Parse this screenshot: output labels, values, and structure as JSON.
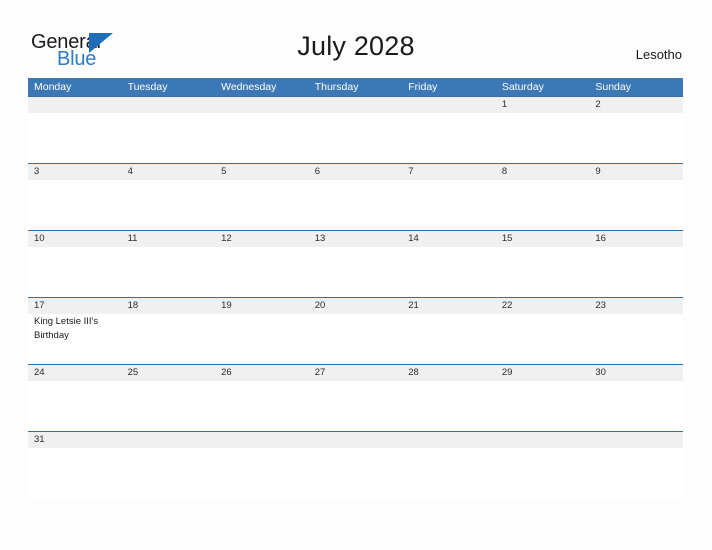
{
  "brand": {
    "name_part1": "General",
    "name_part2": "Blue",
    "triangle_color": "#1f6fb8",
    "blue_text_color": "#2d7cc4"
  },
  "header": {
    "title": "July 2028",
    "country": "Lesotho"
  },
  "theme": {
    "header_blue": "#3c78b5",
    "row_border_blue": "#2f6fad",
    "date_band_gray": "#f0f0f0",
    "page_background": "#fdfdfd",
    "text_color": "#1a1a1a"
  },
  "weekdays": [
    "Monday",
    "Tuesday",
    "Wednesday",
    "Thursday",
    "Friday",
    "Saturday",
    "Sunday"
  ],
  "weeks": [
    {
      "days": [
        {
          "num": "",
          "events": []
        },
        {
          "num": "",
          "events": []
        },
        {
          "num": "",
          "events": []
        },
        {
          "num": "",
          "events": []
        },
        {
          "num": "",
          "events": []
        },
        {
          "num": "1",
          "events": []
        },
        {
          "num": "2",
          "events": []
        }
      ]
    },
    {
      "days": [
        {
          "num": "3",
          "events": []
        },
        {
          "num": "4",
          "events": []
        },
        {
          "num": "5",
          "events": []
        },
        {
          "num": "6",
          "events": []
        },
        {
          "num": "7",
          "events": []
        },
        {
          "num": "8",
          "events": []
        },
        {
          "num": "9",
          "events": []
        }
      ]
    },
    {
      "days": [
        {
          "num": "10",
          "events": []
        },
        {
          "num": "11",
          "events": []
        },
        {
          "num": "12",
          "events": []
        },
        {
          "num": "13",
          "events": []
        },
        {
          "num": "14",
          "events": []
        },
        {
          "num": "15",
          "events": []
        },
        {
          "num": "16",
          "events": []
        }
      ]
    },
    {
      "days": [
        {
          "num": "17",
          "events": [
            "King Letsie III's Birthday"
          ]
        },
        {
          "num": "18",
          "events": []
        },
        {
          "num": "19",
          "events": []
        },
        {
          "num": "20",
          "events": []
        },
        {
          "num": "21",
          "events": []
        },
        {
          "num": "22",
          "events": []
        },
        {
          "num": "23",
          "events": []
        }
      ]
    },
    {
      "days": [
        {
          "num": "24",
          "events": []
        },
        {
          "num": "25",
          "events": []
        },
        {
          "num": "26",
          "events": []
        },
        {
          "num": "27",
          "events": []
        },
        {
          "num": "28",
          "events": []
        },
        {
          "num": "29",
          "events": []
        },
        {
          "num": "30",
          "events": []
        }
      ]
    },
    {
      "days": [
        {
          "num": "31",
          "events": []
        },
        {
          "num": "",
          "events": []
        },
        {
          "num": "",
          "events": []
        },
        {
          "num": "",
          "events": []
        },
        {
          "num": "",
          "events": []
        },
        {
          "num": "",
          "events": []
        },
        {
          "num": "",
          "events": []
        }
      ]
    }
  ]
}
